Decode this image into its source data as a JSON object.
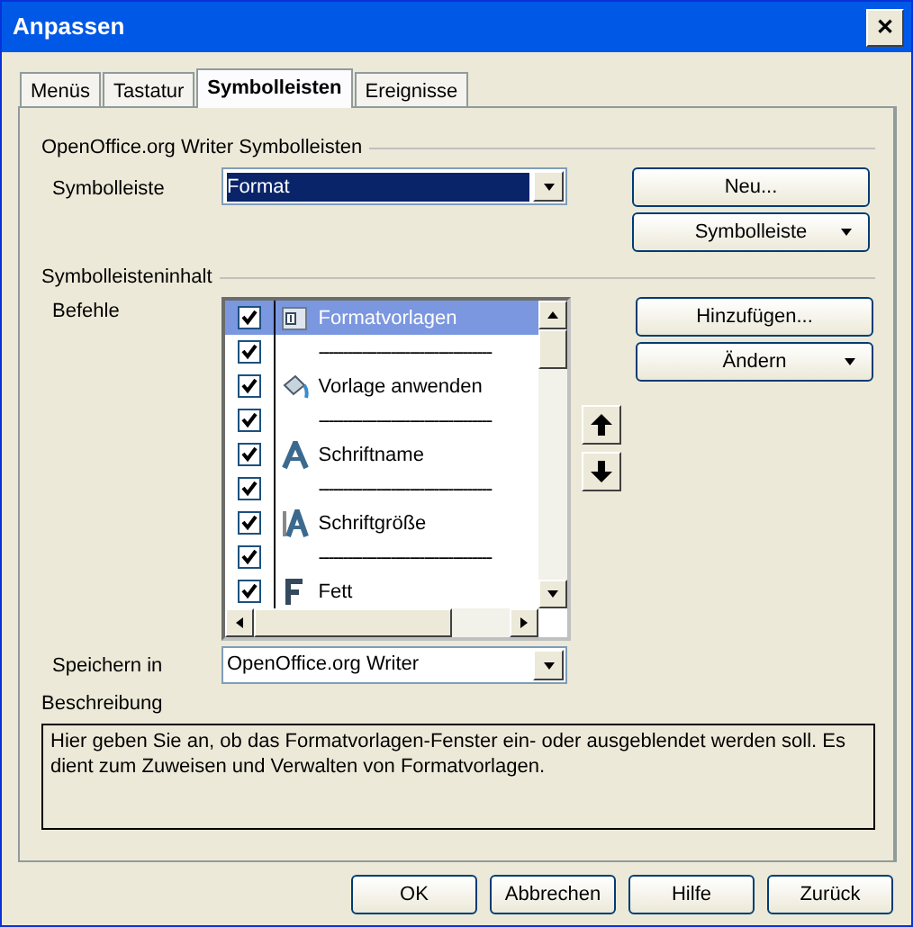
{
  "window": {
    "title": "Anpassen",
    "close": "✕"
  },
  "tabs": [
    {
      "label": "Menüs",
      "selected": false
    },
    {
      "label": "Tastatur",
      "selected": false
    },
    {
      "label": "Symbolleisten",
      "selected": true
    },
    {
      "label": "Ereignisse",
      "selected": false
    }
  ],
  "toolbar_group": {
    "title": "OpenOffice.org Writer Symbolleisten",
    "label": "Symbolleiste",
    "value": "Format",
    "buttons": [
      {
        "label": "Neu...",
        "dropdown": false
      },
      {
        "label": "Symbolleiste",
        "dropdown": true
      }
    ]
  },
  "content_group": {
    "title": "Symbolleisteninhalt",
    "label": "Befehle",
    "buttons": [
      {
        "label": "Hinzufügen...",
        "dropdown": false
      },
      {
        "label": "Ändern",
        "dropdown": true
      }
    ],
    "commands": [
      {
        "kind": "command",
        "label": "Formatvorlagen",
        "checked": true,
        "selected": true
      },
      {
        "kind": "separator",
        "label": "------------------------------------",
        "checked": true,
        "selected": false
      },
      {
        "kind": "command",
        "label": "Vorlage anwenden",
        "checked": true,
        "selected": false
      },
      {
        "kind": "separator",
        "label": "------------------------------------",
        "checked": true,
        "selected": false
      },
      {
        "kind": "command",
        "label": "Schriftname",
        "checked": true,
        "selected": false
      },
      {
        "kind": "separator",
        "label": "------------------------------------",
        "checked": true,
        "selected": false
      },
      {
        "kind": "command",
        "label": "Schriftgröße",
        "checked": true,
        "selected": false
      },
      {
        "kind": "separator",
        "label": "------------------------------------",
        "checked": true,
        "selected": false
      },
      {
        "kind": "command",
        "label": "Fett",
        "checked": true,
        "selected": false
      }
    ]
  },
  "save_in": {
    "label": "Speichern in",
    "value": "OpenOffice.org Writer"
  },
  "description": {
    "title": "Beschreibung",
    "text": "Hier geben Sie an, ob das Formatvorlagen-Fenster ein- oder ausgeblendet werden soll. Es dient zum Zuweisen und Verwalten von Formatvorlagen."
  },
  "buttons": [
    "OK",
    "Abbrechen",
    "Hilfe",
    "Zurück"
  ]
}
